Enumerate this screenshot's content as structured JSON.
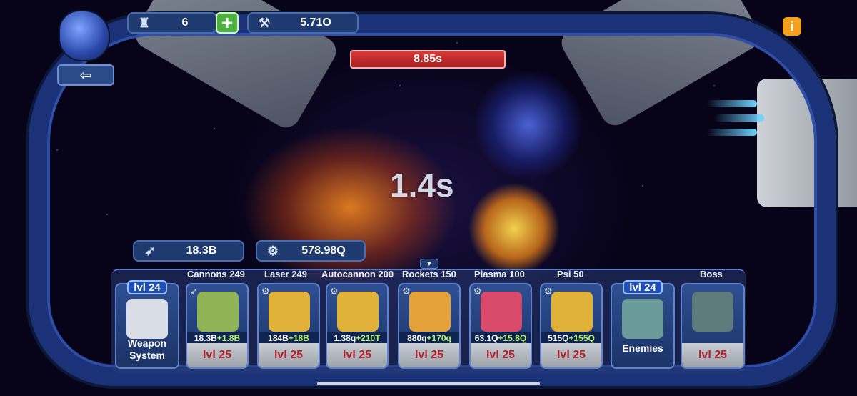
{
  "hud": {
    "medals": {
      "icon": "trophy-icon",
      "value": "6"
    },
    "currency": {
      "icon": "wrench-bolt-icon",
      "value": "5.71O"
    },
    "wave_timer": "8.85s",
    "countdown": "1.4s",
    "damage_stat": {
      "icon": "wing-icon",
      "value": "18.3B"
    },
    "power_stat": {
      "icon": "gear-eye-icon",
      "value": "578.98Q"
    }
  },
  "columns": [
    "Cannons 249",
    "Laser 249",
    "Autocannon 200",
    "Rockets 150",
    "Plasma 100",
    "Psi 50",
    "Boss"
  ],
  "weapon_system": {
    "level": "lvl 24",
    "title_line1": "Weapon",
    "title_line2": "System"
  },
  "weapons": [
    {
      "name": "cannons",
      "dps": "18.3B",
      "gain": "+1.8B",
      "level": "lvl 25",
      "color": "#8fb356"
    },
    {
      "name": "laser",
      "dps": "184B",
      "gain": "+18B",
      "level": "lvl 25",
      "color": "#e0b23a"
    },
    {
      "name": "autocannon",
      "dps": "1.38q",
      "gain": "+210T",
      "level": "lvl 25",
      "color": "#e0b23a"
    },
    {
      "name": "rockets",
      "dps": "880q",
      "gain": "+170q",
      "level": "lvl 25",
      "color": "#e6a23a"
    },
    {
      "name": "plasma",
      "dps": "63.1Q",
      "gain": "+15.8Q",
      "level": "lvl 25",
      "color": "#d94a6a"
    },
    {
      "name": "psi",
      "dps": "515Q",
      "gain": "+155Q",
      "level": "lvl 25",
      "color": "#e0b23a"
    }
  ],
  "enemies": {
    "level": "lvl 24",
    "title": "Enemies"
  },
  "boss": {
    "level": "lvl 25"
  }
}
